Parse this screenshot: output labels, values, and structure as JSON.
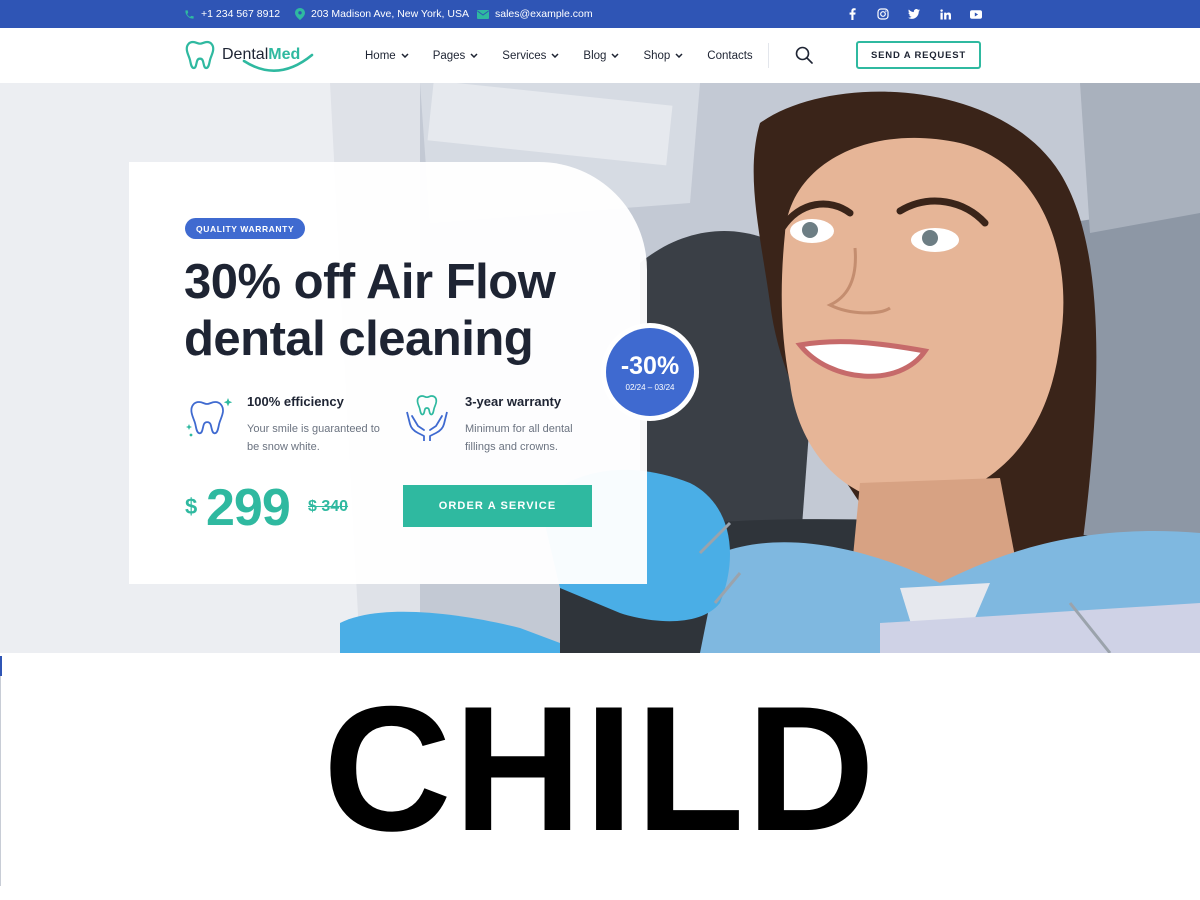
{
  "topbar": {
    "phone": "+1 234 567 8912",
    "address": "203 Madison Ave, New York, USA",
    "email": "sales@example.com",
    "socials": [
      "facebook-icon",
      "instagram-icon",
      "twitter-icon",
      "linkedin-icon",
      "youtube-icon"
    ],
    "background": "#2f55b5"
  },
  "brand": {
    "name_part1": "Dental",
    "name_part2": "Med",
    "accent": "#2fb9a0"
  },
  "nav": {
    "items": [
      {
        "label": "Home",
        "has_dropdown": true
      },
      {
        "label": "Pages",
        "has_dropdown": true
      },
      {
        "label": "Services",
        "has_dropdown": true
      },
      {
        "label": "Blog",
        "has_dropdown": true
      },
      {
        "label": "Shop",
        "has_dropdown": true
      },
      {
        "label": "Contacts",
        "has_dropdown": false
      }
    ],
    "search_icon": "search-icon",
    "cta_label": "SEND A REQUEST"
  },
  "hero": {
    "badge": "QUALITY WARRANTY",
    "headline_line1": "30% off Air Flow",
    "headline_line2": "dental cleaning",
    "features": [
      {
        "icon": "tooth-sparkle-icon",
        "title": "100% efficiency",
        "desc": "Your smile is guaranteed to be snow white."
      },
      {
        "icon": "tooth-hands-icon",
        "title": "3-year warranty",
        "desc": "Minimum for all dental fillings and crowns."
      }
    ],
    "price": {
      "currency": "$",
      "current": "299",
      "old": "$ 340"
    },
    "order_label": "ORDER A SERVICE",
    "discount": {
      "percent": "-30%",
      "dates": "02/24 – 03/24"
    },
    "colors": {
      "primary": "#3f6ad0",
      "accent": "#2fb9a0"
    }
  },
  "caption": {
    "text": "CHILD"
  }
}
